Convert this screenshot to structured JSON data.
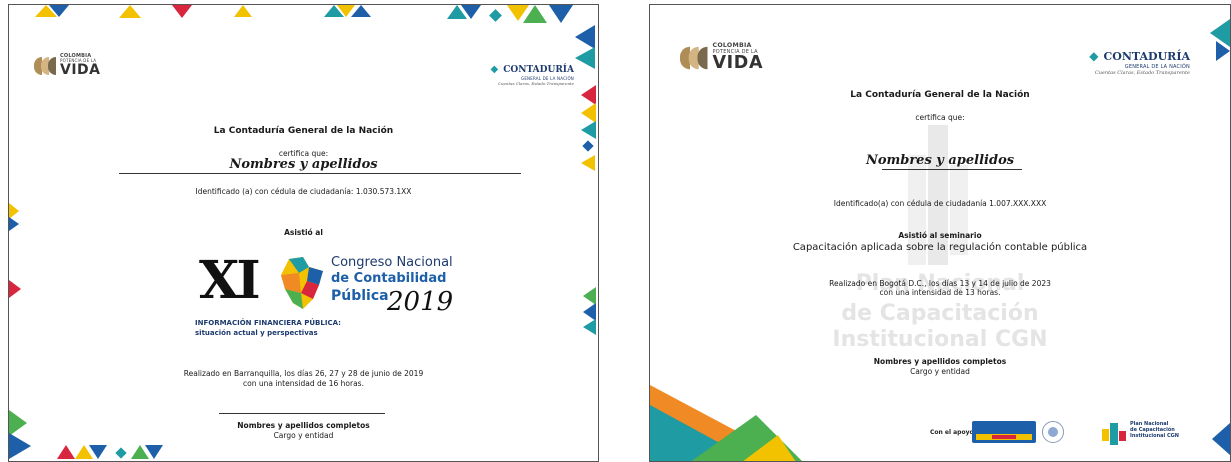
{
  "left_certificate": {
    "brand_left": {
      "small": "COLOMBIA",
      "small2": "POTENCIA DE LA",
      "main": "VIDA"
    },
    "brand_right": {
      "main": "CONTADURÍA",
      "sub": "GENERAL DE LA NACIÓN",
      "tagline": "Cuentas Claras, Estado Transparente"
    },
    "issuer": "La Contaduría General de la Nación",
    "certifies": "certifica que:",
    "name": "Nombres y apellidos",
    "id_text": "Identificado (a) con cédula de ciudadanía: 1.030.573.1XX",
    "attended": "Asistió al",
    "event_logo": {
      "numeral": "XI",
      "line1": "Congreso Nacional",
      "line2": "de Contabilidad",
      "line3": "Pública",
      "year": "2019",
      "subtitle1": "INFORMACIÓN FINANCIERA PÚBLICA:",
      "subtitle2": "situación actual y perspectivas"
    },
    "place_line1": "Realizado en Barranquilla, los días 26, 27 y 28 de junio de 2019",
    "place_line2": "con una intensidad de 16 horas.",
    "signer_name": "Nombres y apellidos completos",
    "signer_role": "Cargo y entidad"
  },
  "right_certificate": {
    "brand_left": {
      "small": "COLOMBIA",
      "small2": "POTENCIA DE LA",
      "main": "VIDA"
    },
    "brand_right": {
      "main": "CONTADURÍA",
      "sub": "GENERAL DE LA NACIÓN",
      "tagline": "Cuentas Claras, Estado Transparente"
    },
    "issuer": "La Contaduría General de la Nación",
    "certifies": "certifica que:",
    "name": "Nombres y apellidos",
    "id_text": "Identificado(a) con cédula de ciudadanía 1.007.XXX.XXX",
    "attended": "Asistió al seminario",
    "seminar": "Capacitación aplicada sobre la regulación contable pública",
    "place_line1": "Realizado en Bogotá D.C., los días 13 y 14 de julio de 2023",
    "place_line2": "con una intensidad de 13 horas.",
    "watermark1": "Plan Nacional",
    "watermark2": "de Capacitación",
    "watermark3": "Institucional CGN",
    "signer_name": "Nombres y apellidos completos",
    "signer_role": "Cargo y entidad",
    "support_label": "Con el apoyo de",
    "plan_logo": {
      "l1": "Plan Nacional",
      "l2": "de Capacitación",
      "l3": "Institucional CGN"
    }
  },
  "colors": {
    "yellow": "#f2c200",
    "red": "#d7263d",
    "teal": "#1f9ba3",
    "blue": "#1d5fa8",
    "green": "#4caf50",
    "orange": "#f08a24",
    "navy": "#1d3b6e"
  }
}
